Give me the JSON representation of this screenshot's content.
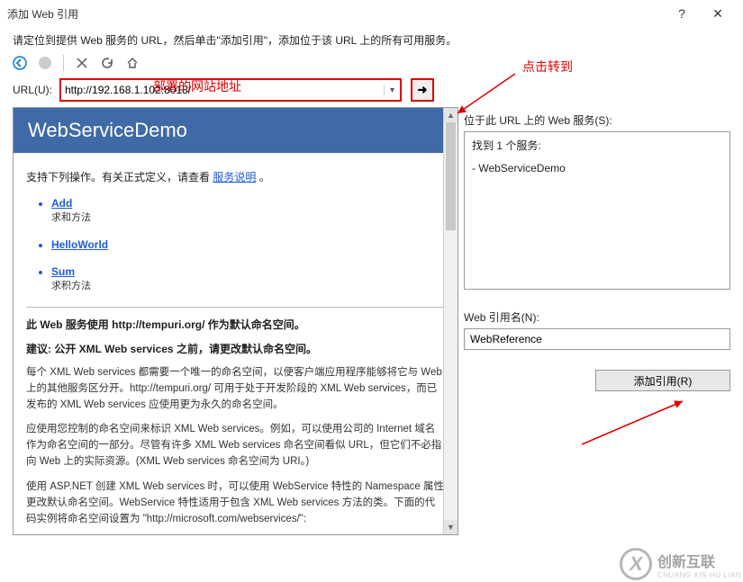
{
  "window": {
    "title": "添加 Web 引用",
    "help": "?",
    "close": "✕"
  },
  "instruction": "请定位到提供 Web 服务的 URL，然后单击\"添加引用\"，添加位于该 URL 上的所有可用服务。",
  "annotations": {
    "deploy_addr": "部署的网站地址",
    "click_go": "点击转到"
  },
  "toolbar": {
    "back_icon": "back-arrow",
    "stop_icon": "stop",
    "refresh_icon": "refresh",
    "home_icon": "home",
    "close_icon": "close"
  },
  "url": {
    "label": "URL(U):",
    "value": "http://192.168.1.102:8018/",
    "go_label": "➜"
  },
  "service": {
    "header": "WebServiceDemo",
    "intro_prefix": "支持下列操作。有关正式定义，请查看",
    "intro_link": "服务说明",
    "intro_suffix": "。",
    "ops": [
      {
        "name": "Add",
        "desc": "求和方法"
      },
      {
        "name": "HelloWorld",
        "desc": ""
      },
      {
        "name": "Sum",
        "desc": "求积方法"
      }
    ],
    "namespace_line": "此 Web 服务使用 http://tempuri.org/ 作为默认命名空间。",
    "recommend_line": "建议: 公开 XML Web services 之前，请更改默认命名空间。",
    "para1": "每个 XML Web services 都需要一个唯一的命名空间，以便客户端应用程序能够将它与 Web 上的其他服务区分开。http://tempuri.org/ 可用于处于开发阶段的 XML Web services，而已发布的 XML Web services 应使用更为永久的命名空间。",
    "para2": "应使用您控制的命名空间来标识 XML Web services。例如，可以使用公司的 Internet 域名作为命名空间的一部分。尽管有许多 XML Web services 命名空间看似 URL，但它们不必指向 Web 上的实际资源。(XML Web services 命名空间为 URI。)",
    "para3": "使用 ASP.NET 创建 XML Web services 时，可以使用 WebService 特性的 Namespace 属性更改默认命名空间。WebService 特性适用于包含 XML Web services 方法的类。下面的代码实例将命名空间设置为 \"http://microsoft.com/webservices/\":"
  },
  "right": {
    "services_label": "位于此 URL 上的 Web 服务(S):",
    "found": "找到 1 个服务:",
    "found_item": "- WebServiceDemo",
    "refname_label": "Web 引用名(N):",
    "refname_value": "WebReference",
    "add_button": "添加引用(R)"
  },
  "watermark": {
    "brand": "创新互联",
    "sub": "CHUANG XIN HU LIAN"
  }
}
